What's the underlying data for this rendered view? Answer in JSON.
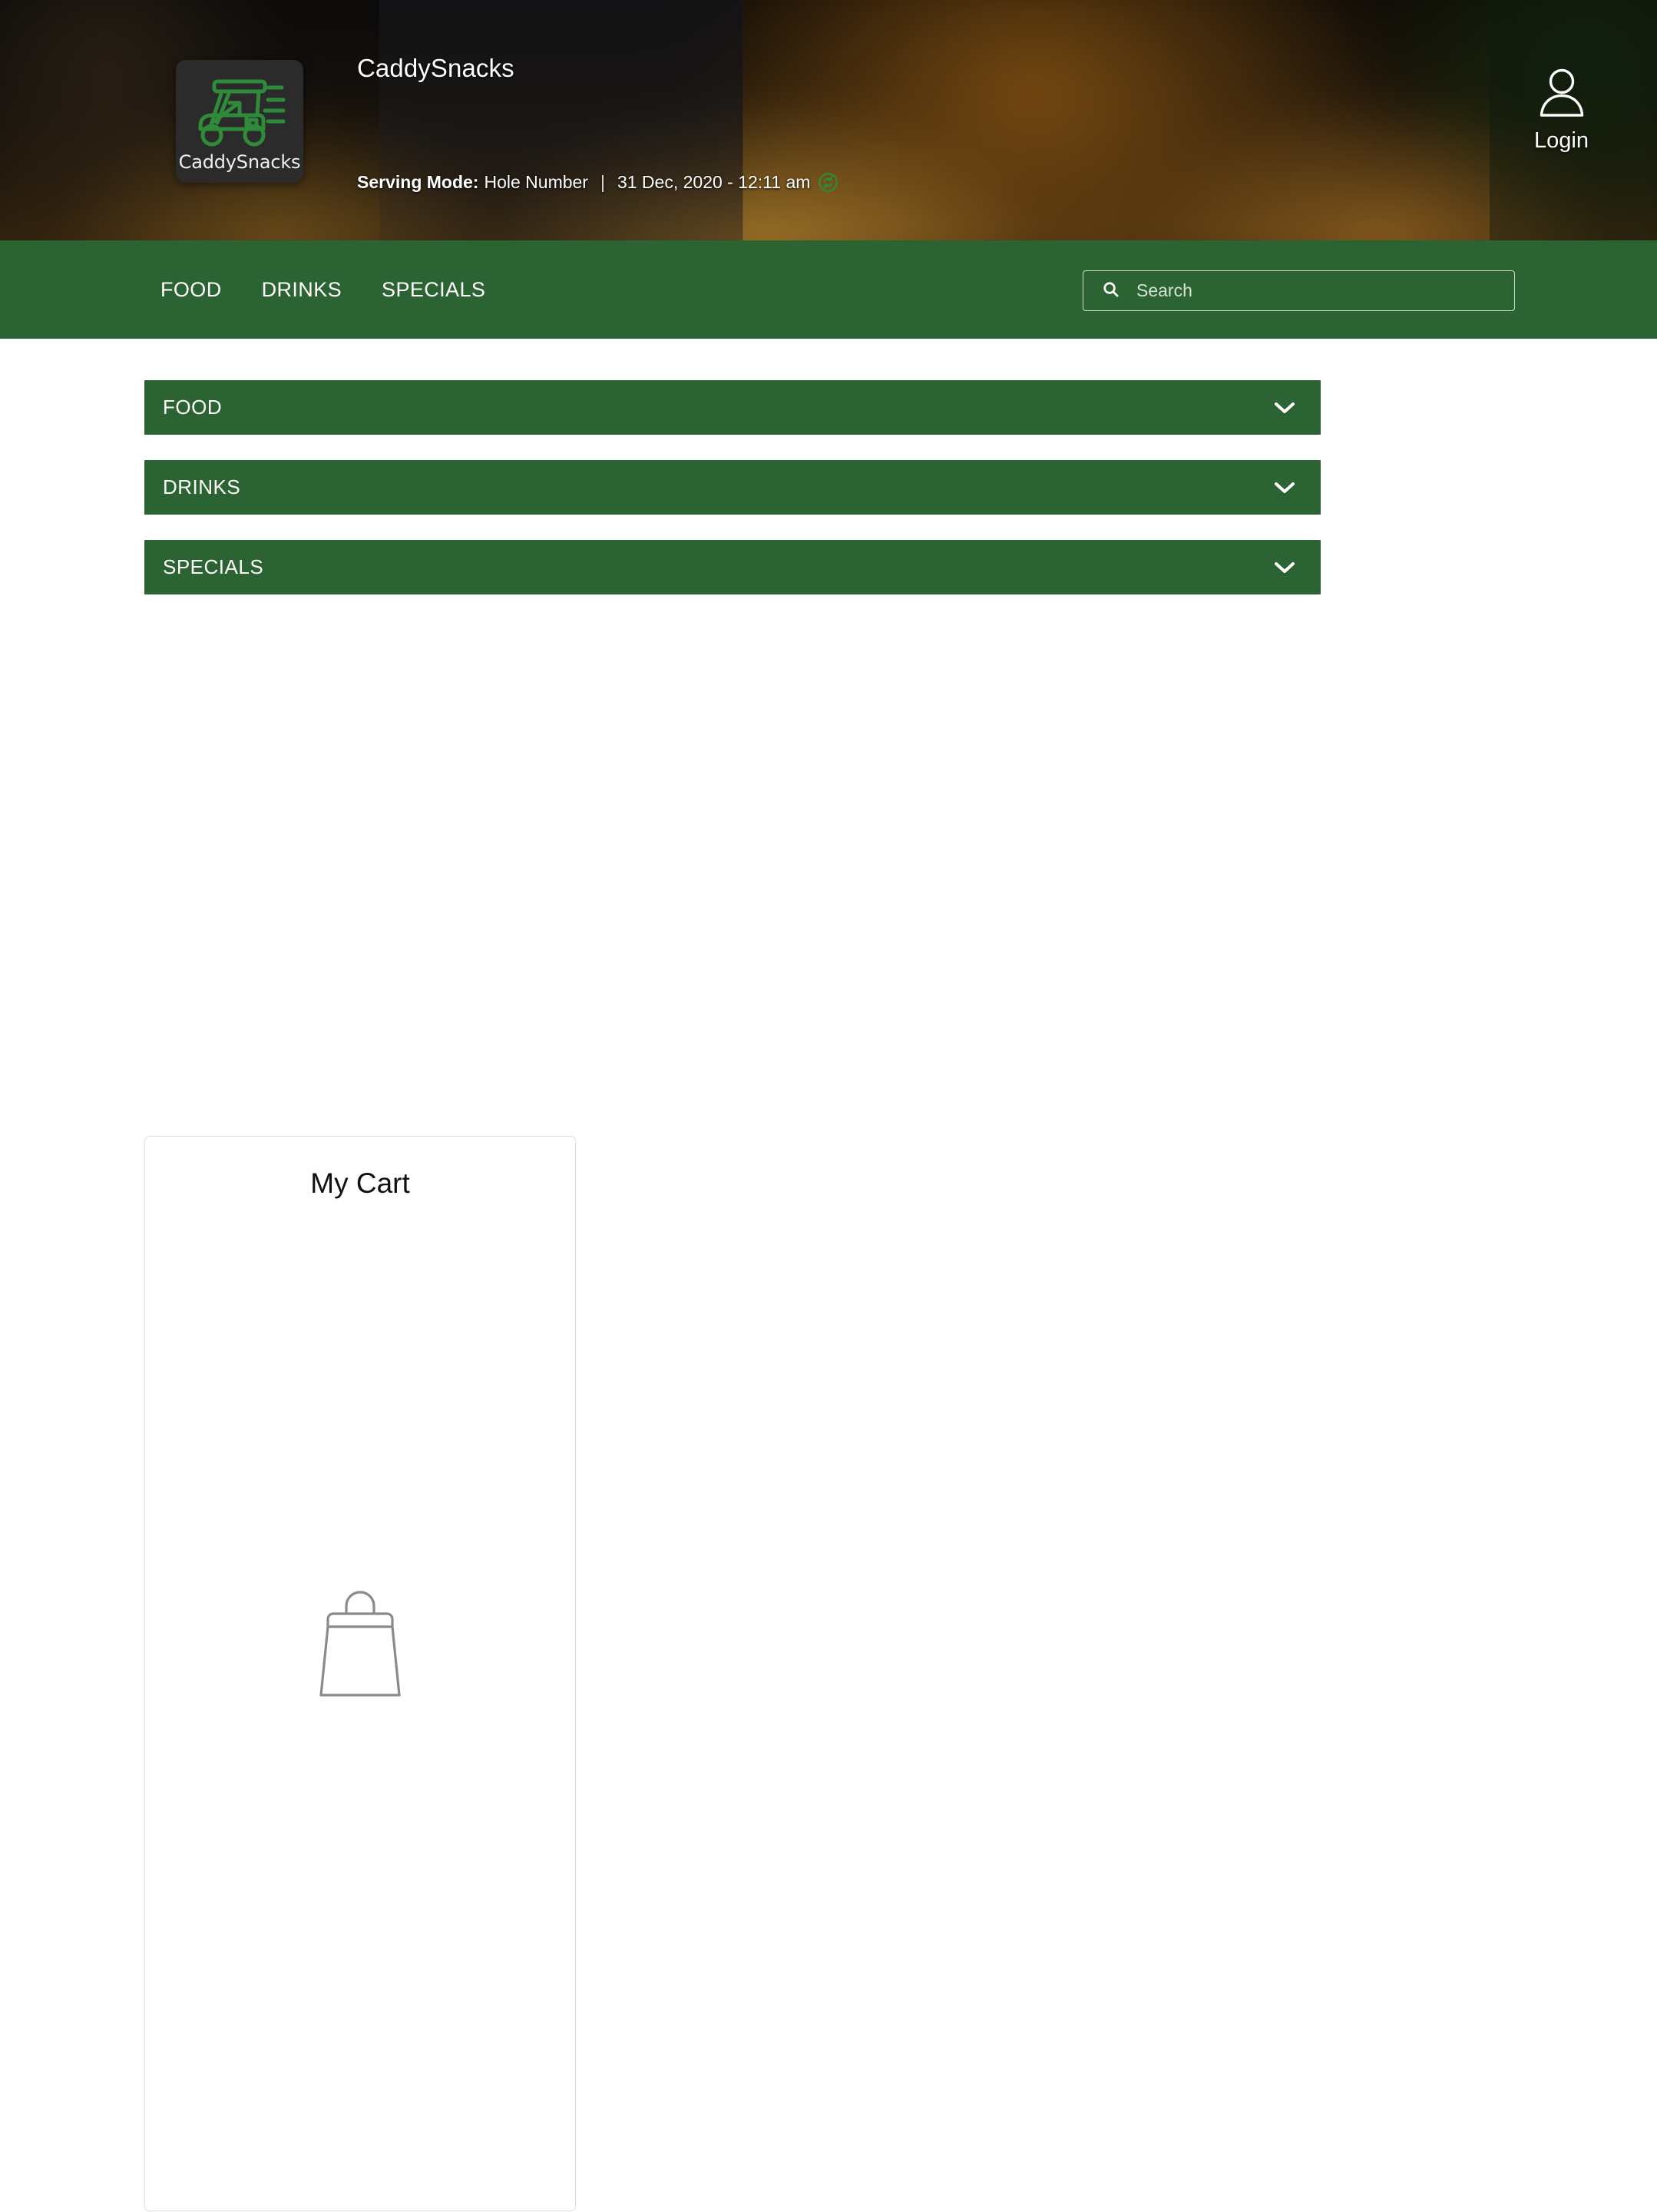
{
  "theme": {
    "brand_green": "#2b6332",
    "logo_green": "#2f8a3a",
    "page_bg": "#ffffff",
    "card_border": "#e2e2e2"
  },
  "header": {
    "logo_caption": "CaddySnacks",
    "logo_icon": "golf-cart-icon",
    "title": "CaddySnacks",
    "serving_mode_label": "Serving Mode:",
    "serving_mode_value": "Hole Number",
    "separator": "|",
    "datetime": "31 Dec, 2020 - 12:11 am",
    "refresh_icon": "refresh-icon",
    "login_label": "Login",
    "login_icon": "user-icon"
  },
  "navbar": {
    "links": [
      {
        "label": "FOOD"
      },
      {
        "label": "DRINKS"
      },
      {
        "label": "SPECIALS"
      }
    ],
    "search": {
      "icon": "search-icon",
      "placeholder": "Search",
      "value": ""
    }
  },
  "main": {
    "accordions": [
      {
        "label": "FOOD",
        "chevron": "chevron-down-icon",
        "expanded": false
      },
      {
        "label": "DRINKS",
        "chevron": "chevron-down-icon",
        "expanded": false
      },
      {
        "label": "SPECIALS",
        "chevron": "chevron-down-icon",
        "expanded": false
      }
    ]
  },
  "cart": {
    "title": "My Cart",
    "empty_icon": "shopping-bag-icon",
    "items": []
  }
}
